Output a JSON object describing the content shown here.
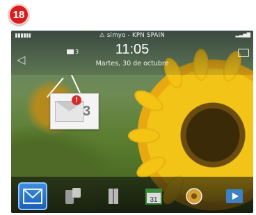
{
  "step_badge": "18",
  "status": {
    "carrier": "simyo - KPN  SPAIN",
    "time": "11:05",
    "date": "Martes, 30 de octubre",
    "message_count": "3"
  },
  "notification_popup": {
    "badge": "!",
    "count": "3"
  },
  "dock": {
    "items": [
      {
        "name": "messages",
        "selected": true
      },
      {
        "name": "contacts",
        "selected": false
      },
      {
        "name": "browser",
        "selected": false
      },
      {
        "name": "calendar",
        "label": "31",
        "selected": false
      },
      {
        "name": "media",
        "selected": false
      },
      {
        "name": "video",
        "selected": false
      }
    ]
  },
  "colors": {
    "accent": "#1c5fb3",
    "badge": "#d81e1e"
  }
}
